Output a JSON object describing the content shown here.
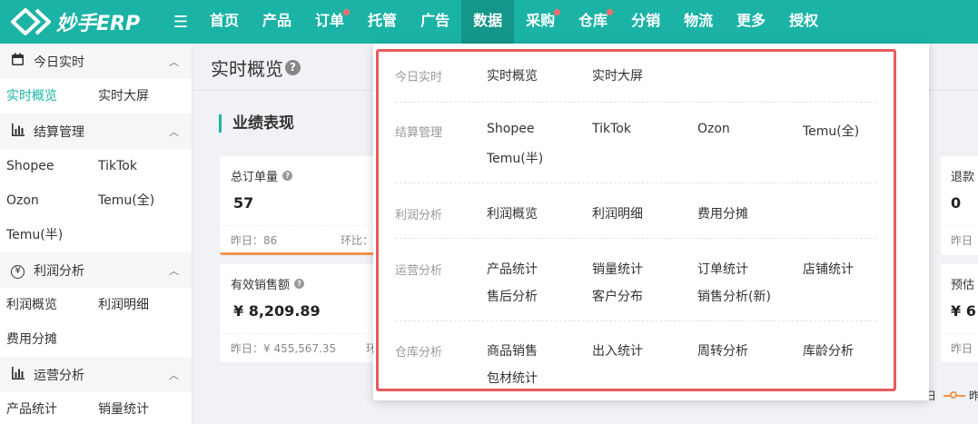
{
  "brand": {
    "name": "妙手ERP"
  },
  "nav": {
    "items": [
      {
        "label": "首页",
        "dot": false
      },
      {
        "label": "产品",
        "dot": false
      },
      {
        "label": "订单",
        "dot": true
      },
      {
        "label": "托管",
        "dot": false
      },
      {
        "label": "广告",
        "dot": false
      },
      {
        "label": "数据",
        "dot": false,
        "active": true
      },
      {
        "label": "采购",
        "dot": true
      },
      {
        "label": "仓库",
        "dot": true
      },
      {
        "label": "分销",
        "dot": false
      },
      {
        "label": "物流",
        "dot": false
      },
      {
        "label": "更多",
        "dot": false
      },
      {
        "label": "授权",
        "dot": false
      }
    ]
  },
  "sidebar": {
    "groups": [
      {
        "label": "今日实时",
        "icon": "calendar-icon",
        "items": [
          "实时概览",
          "实时大屏"
        ]
      },
      {
        "label": "结算管理",
        "icon": "bar-chart-icon",
        "items": [
          "Shopee",
          "TikTok",
          "Ozon",
          "Temu(全)",
          "Temu(半)"
        ]
      },
      {
        "label": "利润分析",
        "icon": "yen-icon",
        "items": [
          "利润概览",
          "利润明细",
          "费用分摊"
        ]
      },
      {
        "label": "运营分析",
        "icon": "bar-chart-icon",
        "items": [
          "产品统计",
          "销量统计"
        ]
      }
    ]
  },
  "main": {
    "page_title": "实时概览",
    "section_title": "业绩表现",
    "cards": {
      "total_orders": {
        "title": "总订单量",
        "value": "57",
        "yesterday": "昨日：86",
        "ratio": "环比："
      },
      "effective_sales": {
        "title": "有效销售额",
        "value": "¥ 8,209.89",
        "yesterday": "昨日：¥ 455,567.35",
        "ratio": "环比："
      },
      "refund": {
        "title": "退款",
        "value": "0",
        "yesterday": "昨日"
      },
      "estimate": {
        "title": "预估",
        "value": "¥ 6",
        "yesterday": "昨日"
      }
    },
    "legend_left": "日",
    "legend_right": "昨"
  },
  "dropdown": {
    "rows": [
      {
        "label": "今日实时",
        "links": [
          "实时概览",
          "实时大屏"
        ]
      },
      {
        "label": "结算管理",
        "links": [
          "Shopee",
          "TikTok",
          "Ozon",
          "Temu(全)",
          "Temu(半)"
        ]
      },
      {
        "label": "利润分析",
        "links": [
          "利润概览",
          "利润明细",
          "费用分摊"
        ]
      },
      {
        "label": "运营分析",
        "links": [
          "产品统计",
          "销量统计",
          "订单统计",
          "店铺统计",
          "售后分析",
          "客户分布",
          "销售分析(新)"
        ]
      },
      {
        "label": "仓库分析",
        "links": [
          "商品销售",
          "出入统计",
          "周转分析",
          "库龄分析",
          "包材统计"
        ]
      }
    ]
  },
  "colors": {
    "brand": "#1bb3a6",
    "highlight_border": "#e85a5e",
    "chart_line": "#f0934b"
  }
}
